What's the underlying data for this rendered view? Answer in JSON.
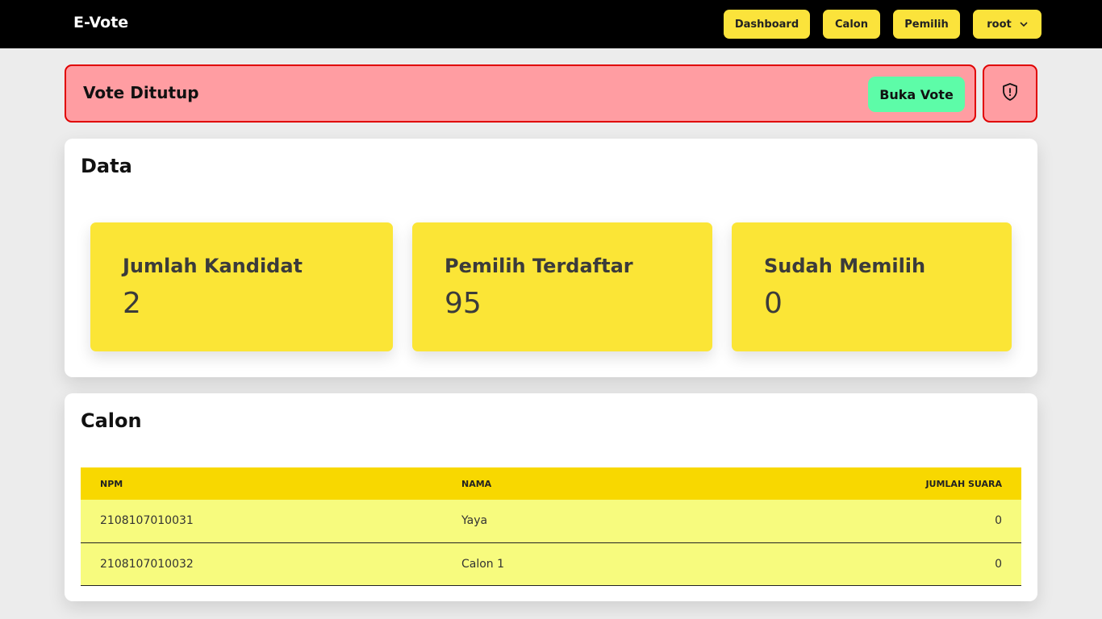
{
  "nav": {
    "brand": "E-Vote",
    "items": [
      "Dashboard",
      "Calon",
      "Pemilih"
    ],
    "user": "root"
  },
  "alert": {
    "title": "Vote Ditutup",
    "button": "Buka Vote",
    "colors": {
      "background": "#ff9da2",
      "border": "#e00000",
      "button": "#5dfca8"
    }
  },
  "data_section": {
    "title": "Data",
    "stats": [
      {
        "label": "Jumlah Kandidat",
        "value": "2"
      },
      {
        "label": "Pemilih Terdaftar",
        "value": "95"
      },
      {
        "label": "Sudah Memilih",
        "value": "0"
      }
    ]
  },
  "calon_section": {
    "title": "Calon",
    "columns": [
      "NPM",
      "NAMA",
      "JUMLAH SUARA"
    ],
    "rows": [
      {
        "npm": "2108107010031",
        "nama": "Yaya",
        "suara": "0"
      },
      {
        "npm": "2108107010032",
        "nama": "Calon 1",
        "suara": "0"
      }
    ]
  },
  "icons": {
    "shield": "shield-alert-icon",
    "chevron": "chevron-down-icon"
  },
  "colors": {
    "accent": "#fbe33b",
    "header_row": "#f8d800",
    "row": "#f7fb7e"
  }
}
